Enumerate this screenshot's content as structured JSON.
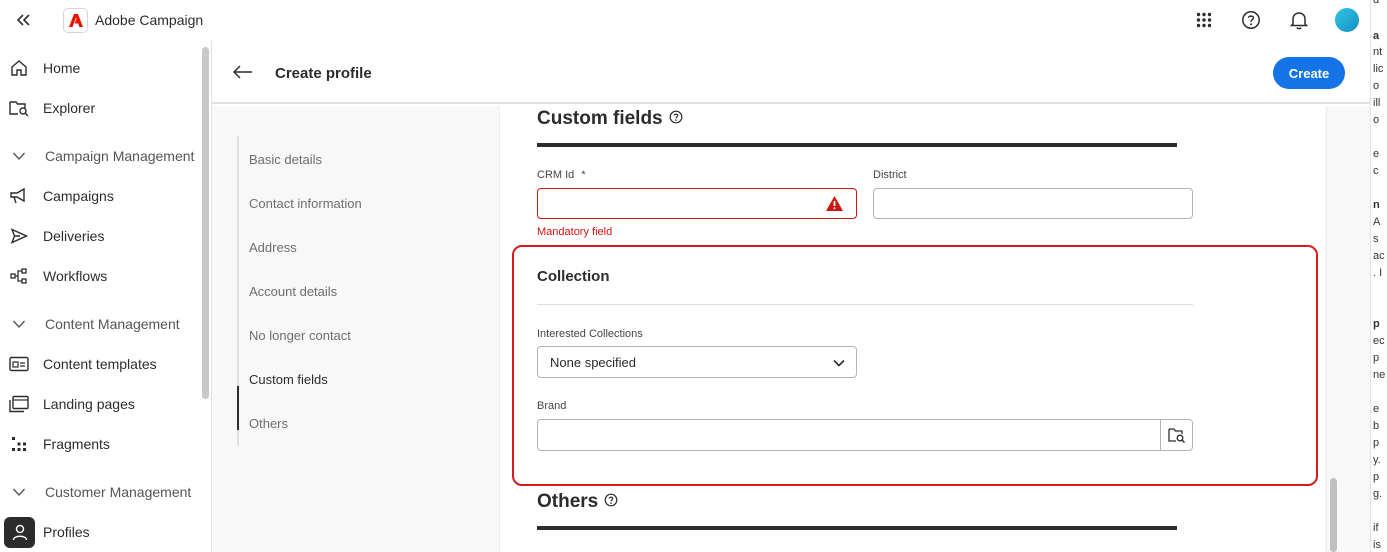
{
  "app": {
    "title": "Adobe Campaign"
  },
  "colors": {
    "accent": "#1473e6",
    "error": "#d31510",
    "highlight": "#d91a1a",
    "avatar": "#1fa7d3"
  },
  "topbar": {
    "icons": [
      "apps-grid-icon",
      "help-icon",
      "bell-icon",
      "avatar"
    ]
  },
  "sidebar": {
    "items": [
      {
        "label": "Home",
        "icon": "home-icon",
        "type": "item"
      },
      {
        "label": "Explorer",
        "icon": "explorer-icon",
        "type": "item"
      },
      {
        "label": "Campaign Management",
        "icon": "chevron-down-icon",
        "type": "section"
      },
      {
        "label": "Campaigns",
        "icon": "megaphone-icon",
        "type": "item"
      },
      {
        "label": "Deliveries",
        "icon": "send-icon",
        "type": "item"
      },
      {
        "label": "Workflows",
        "icon": "workflow-icon",
        "type": "item"
      },
      {
        "label": "Content Management",
        "icon": "chevron-down-icon",
        "type": "section"
      },
      {
        "label": "Content templates",
        "icon": "template-icon",
        "type": "item"
      },
      {
        "label": "Landing pages",
        "icon": "landing-page-icon",
        "type": "item"
      },
      {
        "label": "Fragments",
        "icon": "fragments-icon",
        "type": "item"
      },
      {
        "label": "Customer Management",
        "icon": "chevron-down-icon",
        "type": "section"
      },
      {
        "label": "Profiles",
        "icon": "user-icon",
        "type": "item",
        "active": true
      }
    ]
  },
  "header": {
    "title": "Create profile",
    "create_label": "Create"
  },
  "steps": [
    {
      "label": "Basic details"
    },
    {
      "label": "Contact information"
    },
    {
      "label": "Address"
    },
    {
      "label": "Account details"
    },
    {
      "label": "No longer contact"
    },
    {
      "label": "Custom fields",
      "active": true
    },
    {
      "label": "Others"
    }
  ],
  "custom_fields": {
    "heading": "Custom fields",
    "crm_id": {
      "label": "CRM Id",
      "required_mark": "*",
      "value": "",
      "error": "Mandatory field"
    },
    "district": {
      "label": "District",
      "value": ""
    }
  },
  "collection": {
    "title": "Collection",
    "interested_collections": {
      "label": "Interested Collections",
      "value": "None specified"
    },
    "brand": {
      "label": "Brand",
      "value": ""
    }
  },
  "others": {
    "heading": "Others"
  },
  "edge_text": [
    "d",
    "a",
    "nt",
    "lic",
    "o",
    "ill",
    "o",
    "e",
    "c",
    "n",
    "A",
    "s",
    "ac",
    ". I",
    "p",
    "ec",
    "p",
    "ne",
    "e",
    "b",
    "p",
    "y.",
    "p",
    "g.",
    "if",
    "is"
  ]
}
